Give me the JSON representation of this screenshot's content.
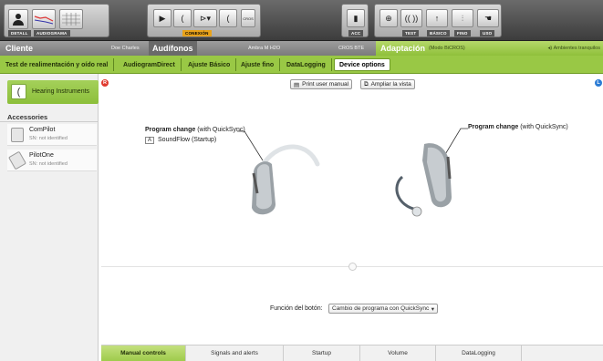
{
  "toolbar": {
    "detail_label": "DETALL",
    "audiogram_label": "AUDIOGRAMA",
    "conexion_label": "CONEXIÓN",
    "cros_label": "CROS",
    "acc_label": "ACC",
    "test_label": "TEST",
    "basico_label": "BÁSICO",
    "fino_label": "FINO",
    "uso_label": "USO"
  },
  "header": {
    "cliente": "Cliente",
    "client_name": "Doe Charles",
    "audifonos": "Audífonos",
    "device_model": "Ambra M H2O",
    "cros_bte": "CROS BTE",
    "adaptacion": "Adaptación",
    "mode": "(Modo BiCROS)",
    "environment": "Ambientes tranquilos"
  },
  "tabs": [
    "Test de realimentación y oído real",
    "AudiogramDirect",
    "Ajuste Básico",
    "Ajuste fino",
    "DataLogging",
    "Device options"
  ],
  "sidebar": {
    "hearing_instruments": "Hearing Instruments",
    "accessories_title": "Accessories",
    "accessories": [
      {
        "name": "ComPilot",
        "sn": "SN: not identified"
      },
      {
        "name": "PilotOne",
        "sn": "SN: not identified"
      }
    ]
  },
  "main": {
    "print_label": "Print user manual",
    "zoom_label": "Ampliar la vista",
    "left_program_title": "Program change",
    "left_program_suffix": "(with QuickSync)",
    "program_letter": "A",
    "program_name": "SoundFlow (Startup)",
    "right_program_title": "Program change",
    "right_program_suffix": "(with QuickSync)",
    "button_function_label": "Función del botón:",
    "button_function_value": "Cambio de programa con QuickSync"
  },
  "bottom_tabs": [
    "Manual controls",
    "Signals and alerts",
    "Startup",
    "Volume",
    "DataLogging"
  ],
  "colors": {
    "accent_green": "#8fc03a",
    "left_indicator": "#e03a2f",
    "right_indicator": "#2a7bd4"
  }
}
